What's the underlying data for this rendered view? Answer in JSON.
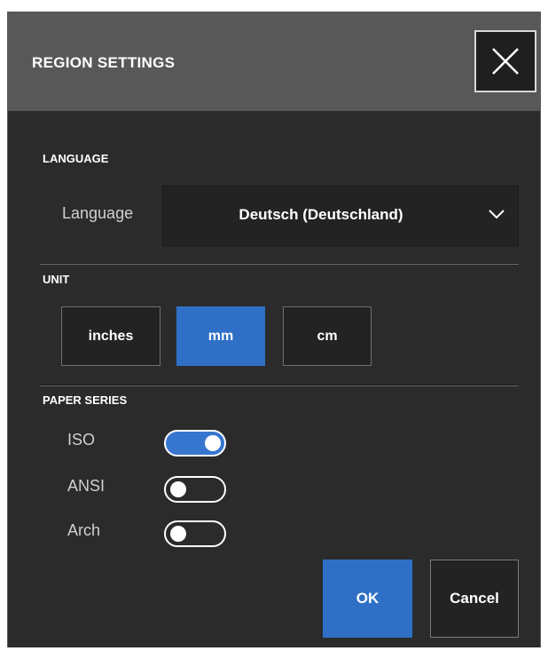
{
  "dialog": {
    "title": "REGION SETTINGS",
    "close_icon": "close-icon"
  },
  "language_section": {
    "heading": "LANGUAGE",
    "field_label": "Language",
    "selected_value": "Deutsch (Deutschland)",
    "dropdown_icon": "chevron-down-icon"
  },
  "unit_section": {
    "heading": "UNIT",
    "options": [
      {
        "label": "inches",
        "selected": false
      },
      {
        "label": "mm",
        "selected": true
      },
      {
        "label": "cm",
        "selected": false
      }
    ]
  },
  "paper_series_section": {
    "heading": "PAPER SERIES",
    "toggles": [
      {
        "label": "ISO",
        "on": true
      },
      {
        "label": "ANSI",
        "on": false
      },
      {
        "label": "Arch",
        "on": false
      }
    ]
  },
  "actions": {
    "ok_label": "OK",
    "cancel_label": "Cancel"
  },
  "colors": {
    "accent": "#2f70c6",
    "background": "#2b2b2b",
    "header": "#585858"
  }
}
